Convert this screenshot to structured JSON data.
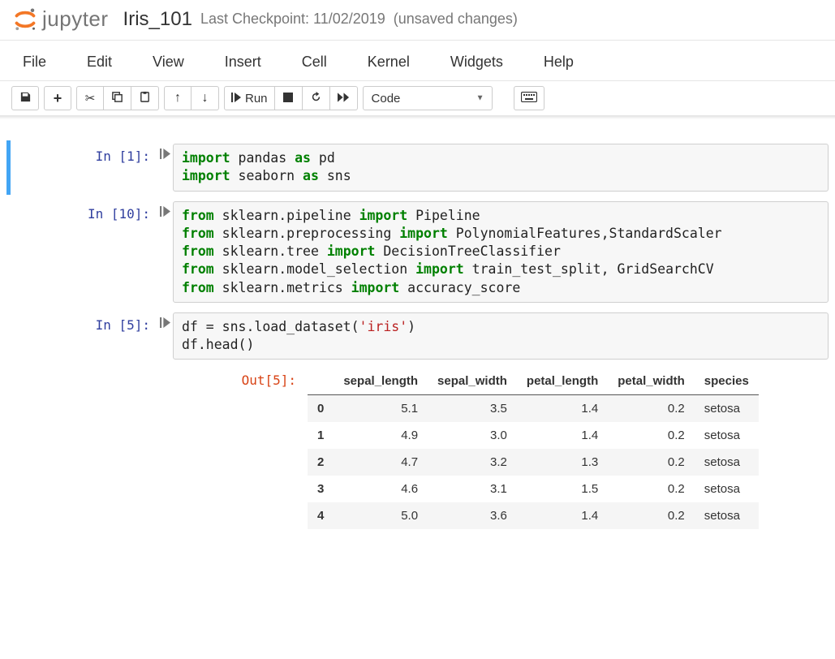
{
  "header": {
    "logo_text": "jupyter",
    "notebook_name": "Iris_101",
    "checkpoint": "Last Checkpoint: 11/02/2019",
    "unsaved": "(unsaved changes)"
  },
  "menubar": [
    "File",
    "Edit",
    "View",
    "Insert",
    "Cell",
    "Kernel",
    "Widgets",
    "Help"
  ],
  "toolbar": {
    "run_label": "Run",
    "celltype_selected": "Code"
  },
  "cells": [
    {
      "kind": "code",
      "exec_count": 1,
      "selected": true,
      "source_tokens": [
        {
          "t": "import",
          "c": "kw-green"
        },
        {
          "t": " pandas "
        },
        {
          "t": "as",
          "c": "kw-green"
        },
        {
          "t": " pd\n"
        },
        {
          "t": "import",
          "c": "kw-green"
        },
        {
          "t": " seaborn "
        },
        {
          "t": "as",
          "c": "kw-green"
        },
        {
          "t": " sns"
        }
      ]
    },
    {
      "kind": "code",
      "exec_count": 10,
      "source_tokens": [
        {
          "t": "from",
          "c": "kw-green"
        },
        {
          "t": " sklearn.pipeline "
        },
        {
          "t": "import",
          "c": "kw-green"
        },
        {
          "t": " Pipeline\n"
        },
        {
          "t": "from",
          "c": "kw-green"
        },
        {
          "t": " sklearn.preprocessing "
        },
        {
          "t": "import",
          "c": "kw-green"
        },
        {
          "t": " PolynomialFeatures,StandardScaler\n"
        },
        {
          "t": "from",
          "c": "kw-green"
        },
        {
          "t": " sklearn.tree "
        },
        {
          "t": "import",
          "c": "kw-green"
        },
        {
          "t": " DecisionTreeClassifier\n"
        },
        {
          "t": "from",
          "c": "kw-green"
        },
        {
          "t": " sklearn.model_selection "
        },
        {
          "t": "import",
          "c": "kw-green"
        },
        {
          "t": " train_test_split, GridSearchCV\n"
        },
        {
          "t": "from",
          "c": "kw-green"
        },
        {
          "t": " sklearn.metrics "
        },
        {
          "t": "import",
          "c": "kw-green"
        },
        {
          "t": " accuracy_score"
        }
      ]
    },
    {
      "kind": "code",
      "exec_count": 5,
      "source_tokens": [
        {
          "t": "df = sns.load_dataset("
        },
        {
          "t": "'iris'",
          "c": "kw-str"
        },
        {
          "t": ")\n"
        },
        {
          "t": "df.head()"
        }
      ],
      "output": {
        "exec_count": 5,
        "dataframe": {
          "columns": [
            "sepal_length",
            "sepal_width",
            "petal_length",
            "petal_width",
            "species"
          ],
          "index": [
            "0",
            "1",
            "2",
            "3",
            "4"
          ],
          "rows": [
            [
              "5.1",
              "3.5",
              "1.4",
              "0.2",
              "setosa"
            ],
            [
              "4.9",
              "3.0",
              "1.4",
              "0.2",
              "setosa"
            ],
            [
              "4.7",
              "3.2",
              "1.3",
              "0.2",
              "setosa"
            ],
            [
              "4.6",
              "3.1",
              "1.5",
              "0.2",
              "setosa"
            ],
            [
              "5.0",
              "3.6",
              "1.4",
              "0.2",
              "setosa"
            ]
          ],
          "text_cols": [
            4
          ]
        }
      }
    }
  ],
  "chart_data": {
    "type": "table",
    "title": "df.head() — iris dataset",
    "columns": [
      "sepal_length",
      "sepal_width",
      "petal_length",
      "petal_width",
      "species"
    ],
    "index": [
      0,
      1,
      2,
      3,
      4
    ],
    "rows": [
      [
        5.1,
        3.5,
        1.4,
        0.2,
        "setosa"
      ],
      [
        4.9,
        3.0,
        1.4,
        0.2,
        "setosa"
      ],
      [
        4.7,
        3.2,
        1.3,
        0.2,
        "setosa"
      ],
      [
        4.6,
        3.1,
        1.5,
        0.2,
        "setosa"
      ],
      [
        5.0,
        3.6,
        1.4,
        0.2,
        "setosa"
      ]
    ]
  }
}
